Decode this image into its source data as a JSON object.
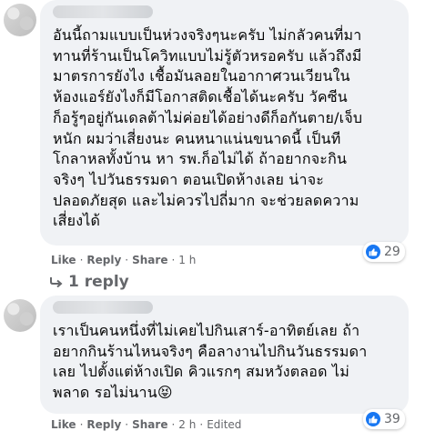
{
  "comments": [
    {
      "text": "อันนี้ถามแบบเป็นห่วงจริงๆนะครับ ไม่กลัวคนที่มา\nทานที่ร้านเป็นโควิทแบบไม่รู้ตัวหรอครับ แล้วถึงมี\nมาตรการยังไง เชื้อมันลอยในอากาศวนเวียนใน\nห้องแอร์ยังไงก็มีโอกาสติดเชื้อได้นะครับ วัคซีน\nก็อรู้ๆอยู่กันเดลต้าไม่ค่อยได้อย่างดีก็อกันตาย/เจ็บ\nหนัก ผมว่าเสี่ยงนะ คนหนาแน่นขนาดนี้ เป็นที\nโกลาหลทั้งบ้าน หา รพ.ก็อไม่ได้ ถ้าอยากจะกิน\nจริงๆ ไปวันธรรมดา ตอนเปิดห้างเลย น่าจะ\nปลอดภัยสุด และไม่ควรไปถี่มาก จะช่วยลดความ\nเสี่ยงได้",
      "like": "Like",
      "reply": "Reply",
      "share": "Share",
      "time": "1 h",
      "reaction_count": "29",
      "replies_label": "1 reply"
    },
    {
      "text": "เราเป็นคนหนึ่งที่ไม่เคยไปกินเสาร์-อาทิตย์เลย ถ้า\nอยากกินร้านไหนจริงๆ คือลางานไปกินวันธรรมดา\nเลย ไปตั้งแต่ห้างเปิด คิวแรกๆ สมหวังตลอด ไม่\nพลาด รอไม่นาน😝",
      "like": "Like",
      "reply": "Reply",
      "share": "Share",
      "time": "2 h",
      "edited": "Edited",
      "reaction_count": "39"
    }
  ],
  "colors": {
    "bubble": "#f0f2f5",
    "meta": "#65676b",
    "like_blue": "#1877f2"
  },
  "icons": {
    "reaction": "thumbs-up-icon",
    "replies": "reply-arrow-icon"
  }
}
